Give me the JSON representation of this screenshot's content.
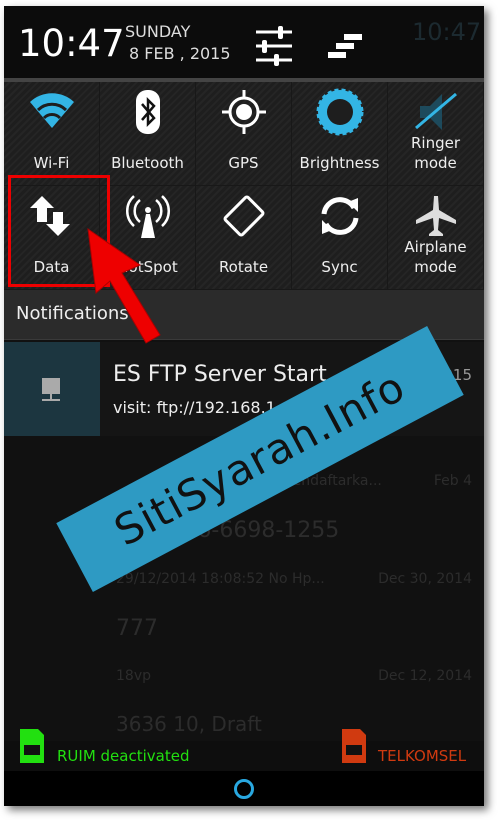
{
  "status": {
    "clock": "10:47",
    "day": "SUNDAY",
    "date": "8 FEB , 2015"
  },
  "tiles": [
    {
      "label": "Wi-Fi",
      "icon": "wifi-icon"
    },
    {
      "label": "Bluetooth",
      "icon": "bluetooth-icon"
    },
    {
      "label": "GPS",
      "icon": "gps-icon"
    },
    {
      "label": "Brightness",
      "icon": "brightness-icon"
    },
    {
      "label": "Ringer mode",
      "icon": "ringer-muted-icon"
    },
    {
      "label": "Data",
      "icon": "data-icon"
    },
    {
      "label": "HotSpot",
      "icon": "hotspot-icon"
    },
    {
      "label": "Rotate",
      "icon": "rotate-icon"
    },
    {
      "label": "Sync",
      "icon": "sync-icon"
    },
    {
      "label": "Airplane mode",
      "icon": "airplane-icon"
    }
  ],
  "notifications": {
    "header": "Notifications",
    "items": [
      {
        "title": "ES FTP Server Start...",
        "time": "06-02-2015",
        "text": "visit: ftp://192.168.1.4:3721/"
      }
    ]
  },
  "background_list": [
    {
      "text": "...ak perlu mendaftarka...",
      "time": "Feb 4"
    },
    {
      "text": "+62 896-6698-1255",
      "time": ""
    },
    {
      "text": "29/12/2014 18:08:52 No Hp...",
      "time": "Dec 30, 2014"
    },
    {
      "text": "777",
      "time": ""
    },
    {
      "text": "18vp",
      "time": "Dec 12, 2014"
    },
    {
      "text": "3636 10, Draft",
      "time": ""
    }
  ],
  "sims": {
    "sim1": "RUIM deactivated",
    "sim2": "TELKOMSEL",
    "sim1_color": "#22e010",
    "sim2_color": "#d03a10"
  },
  "watermark": "SitiSyarah.Info",
  "colors": {
    "accent": "#33b5e5",
    "highlight": "#e00000"
  }
}
